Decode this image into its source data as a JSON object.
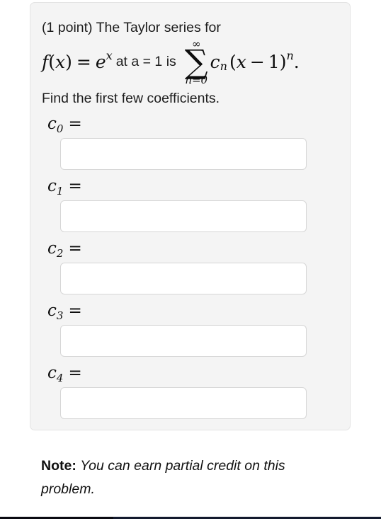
{
  "card": {
    "points_label": "(1 point) The Taylor series for",
    "equation": {
      "f_name": "f",
      "open_paren": "(",
      "var": "x",
      "close_paren": ")",
      "equals": "=",
      "base": "e",
      "exponent": "x",
      "middle_text": "at a = 1 is",
      "sum_upper": "∞",
      "sum_symbol": "∑",
      "sum_lower": "n=0",
      "coef_symbol": "c",
      "coef_index": "n",
      "term_open": "(",
      "term_var": "x",
      "term_minus": "−",
      "term_center": "1",
      "term_close": ")",
      "term_power": "n",
      "period": "."
    },
    "instruction": "Find the first few coefficients.",
    "coefficients": [
      {
        "symbol": "c",
        "sub": "0",
        "eq": "=",
        "value": "",
        "placeholder": ""
      },
      {
        "symbol": "c",
        "sub": "1",
        "eq": "=",
        "value": "",
        "placeholder": ""
      },
      {
        "symbol": "c",
        "sub": "2",
        "eq": "=",
        "value": "",
        "placeholder": ""
      },
      {
        "symbol": "c",
        "sub": "3",
        "eq": "=",
        "value": "",
        "placeholder": ""
      },
      {
        "symbol": "c",
        "sub": "4",
        "eq": "=",
        "value": "",
        "placeholder": ""
      }
    ]
  },
  "note": {
    "label": "Note:",
    "text": "You can earn partial credit on this problem."
  },
  "colors": {
    "page_background": "#ffffff",
    "card_background": "#f4f4f4",
    "card_border": "#e3e3e3",
    "input_background": "#ffffff",
    "input_border": "#d6d6d6",
    "text": "#1a1a1a",
    "bottom_rule": "#0b0b12"
  }
}
